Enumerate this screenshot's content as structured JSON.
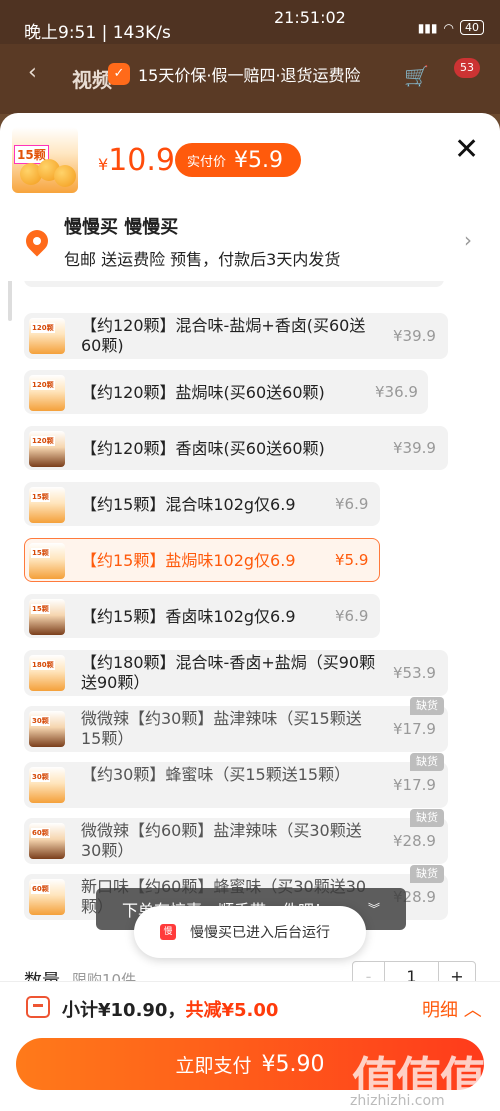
{
  "status_bar": {
    "left": "晚上9:51 | 143K/s",
    "time": "21:51:02",
    "battery": "40"
  },
  "background_page": {
    "title": "视频",
    "cart_badge": "53"
  },
  "guarantee": "15天价保·假一赔四·退货运费险",
  "product": {
    "thumb_tag": "15颗",
    "price": "10.9",
    "pay_label": "实付价",
    "pay_price": "5.9",
    "currency": "¥"
  },
  "address": {
    "name": "慢慢买 慢慢买",
    "desc": "包邮 送运费险 预售，付款后3天内发货"
  },
  "options": [
    {
      "label": "【约120颗】混合味-盐焗+香卤(买60送60颗)",
      "price": "¥39.9",
      "tag": "120颗",
      "oos": false,
      "selected": false
    },
    {
      "label": "【约120颗】盐焗味(买60送60颗)",
      "price": "¥36.9",
      "tag": "120颗",
      "oos": false,
      "selected": false
    },
    {
      "label": "【约120颗】香卤味(买60送60颗)",
      "price": "¥39.9",
      "tag": "120颗",
      "oos": false,
      "selected": false
    },
    {
      "label": "【约15颗】混合味102g仅6.9",
      "price": "¥6.9",
      "tag": "15颗",
      "oos": false,
      "selected": false
    },
    {
      "label": "【约15颗】盐焗味102g仅6.9",
      "price": "¥5.9",
      "tag": "15颗",
      "oos": false,
      "selected": true
    },
    {
      "label": "【约15颗】香卤味102g仅6.9",
      "price": "¥6.9",
      "tag": "15颗",
      "oos": false,
      "selected": false
    },
    {
      "label": "【约180颗】混合味-香卤+盐焗（买90颗送90颗）",
      "price": "¥53.9",
      "tag": "180颗",
      "oos": false,
      "selected": false
    },
    {
      "label": "微微辣【约30颗】盐津辣味（买15颗送15颗）",
      "price": "¥17.9",
      "tag": "30颗",
      "oos": true,
      "selected": false
    },
    {
      "label": "【约30颗】蜂蜜味（买15颗送15颗）",
      "price": "¥17.9",
      "tag": "30颗",
      "oos": true,
      "selected": false
    },
    {
      "label": "微微辣【约60颗】盐津辣味（买30颗送30颗）",
      "price": "¥28.9",
      "tag": "60颗",
      "oos": true,
      "selected": false
    },
    {
      "label": "新口味【约60颗】蜂蜜味（买30颗送30颗）",
      "price": "¥28.9",
      "tag": "60颗",
      "oos": true,
      "selected": false
    }
  ],
  "oos_label": "缺货",
  "tip_toast": "下单有惊喜，顺手带一件吧！",
  "bg_toast": "慢慢买已进入后台运行",
  "quantity": {
    "label": "数量",
    "limit": "限购10件",
    "minus": "-",
    "value": "1",
    "plus": "+"
  },
  "summary": {
    "subtotal": "小计¥10.90，",
    "discount": "共减¥5.00",
    "detail": "明细 ︿"
  },
  "pay_button": {
    "label": "立即支付",
    "amount": "¥5.90"
  },
  "watermark": {
    "logo": "值值值",
    "url": "zhizhizhi.com"
  }
}
